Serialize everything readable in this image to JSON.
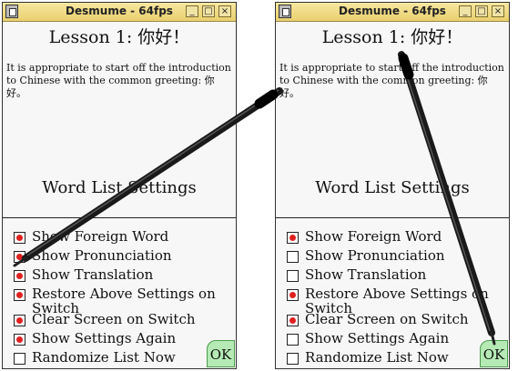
{
  "windows": [
    {
      "title": "Desmume - 64fps",
      "lesson_title": "Lesson 1: 你好！",
      "lesson_text": "It is appropriate to start off the introduction to Chinese with the common greeting: 你好。",
      "settings_title": "Word List Settings",
      "ok_label": "OK",
      "options": [
        {
          "label": "Show Foreign Word",
          "checked": true
        },
        {
          "label": "Show Pronunciation",
          "checked": true
        },
        {
          "label": "Show Translation",
          "checked": true
        },
        {
          "label": "Restore Above Settings on Switch",
          "checked": true
        },
        {
          "label": "Clear Screen on Switch",
          "checked": true
        },
        {
          "label": "Show Settings Again",
          "checked": true
        },
        {
          "label": "Randomize List Now",
          "checked": false
        }
      ]
    },
    {
      "title": "Desmume - 64fps",
      "lesson_title": "Lesson 1: 你好！",
      "lesson_text": "It is appropriate to start off the introduction to Chinese with the common greeting: 你好。",
      "settings_title": "Word List Settings",
      "ok_label": "OK",
      "options": [
        {
          "label": "Show Foreign Word",
          "checked": true
        },
        {
          "label": "Show Pronunciation",
          "checked": false
        },
        {
          "label": "Show Translation",
          "checked": false
        },
        {
          "label": "Restore Above Settings on Switch",
          "checked": true
        },
        {
          "label": "Clear Screen on Switch",
          "checked": true
        },
        {
          "label": "Show Settings Again",
          "checked": false
        },
        {
          "label": "Randomize List Now",
          "checked": false
        }
      ]
    }
  ],
  "colors": {
    "titlebar": "#e9cf6e",
    "checked_dot": "#e02020",
    "ok_button": "#b5eab5"
  },
  "icons": {
    "app": "desmume-app-icon",
    "minimize": "minimize-icon",
    "maximize": "maximize-icon",
    "close": "close-icon"
  }
}
